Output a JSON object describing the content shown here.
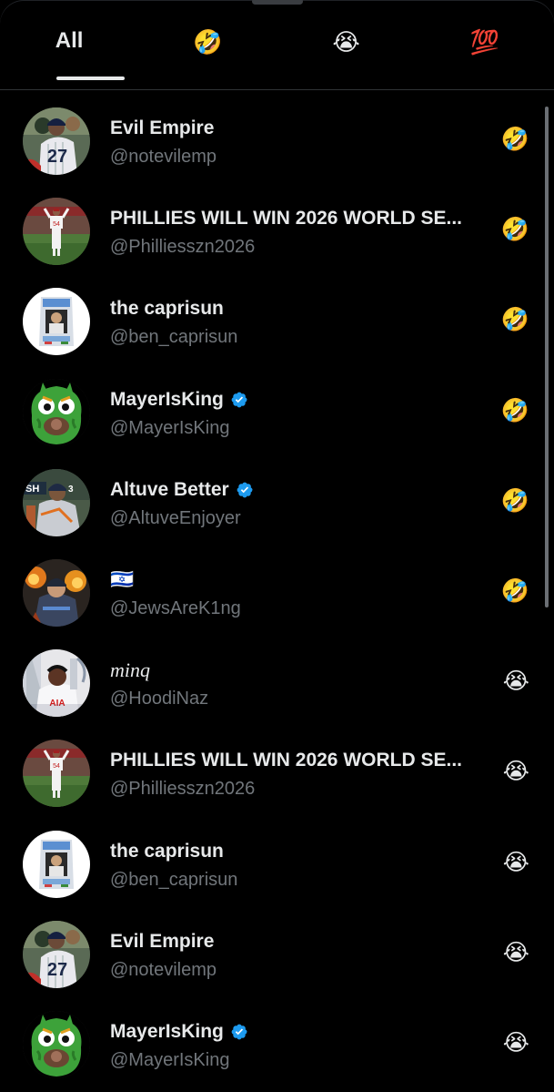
{
  "tabs": [
    {
      "label": "All",
      "type": "text",
      "active": true
    },
    {
      "label": "🤣",
      "type": "emoji",
      "icon": "rolling-laughing-emoji"
    },
    {
      "label": "😭",
      "type": "emoji",
      "icon": "loudly-crying-emoji"
    },
    {
      "label": "💯",
      "type": "emoji",
      "icon": "hundred-points-emoji"
    }
  ],
  "colors": {
    "accent": "#1d9bf0",
    "muted": "#71767b",
    "text": "#e7e9ea",
    "background": "#000000"
  },
  "reactions": [
    {
      "name": "Evil Empire",
      "handle": "@notevilemp",
      "verified": false,
      "reaction": "🤣",
      "avatar": "yankees-player-27"
    },
    {
      "name": "PHILLIES WILL WIN 2026 WORLD SE...",
      "handle": "@Philliesszn2026",
      "verified": false,
      "reaction": "🤣",
      "avatar": "phillies-player-field"
    },
    {
      "name": "the caprisun",
      "handle": "@ben_caprisun",
      "verified": false,
      "reaction": "🤣",
      "avatar": "capri-sun-pouch"
    },
    {
      "name": "MayerIsKing",
      "handle": "@MayerIsKing",
      "verified": true,
      "reaction": "🤣",
      "avatar": "green-mascot"
    },
    {
      "name": "Altuve Better",
      "handle": "@AltuveEnjoyer",
      "verified": true,
      "reaction": "🤣",
      "avatar": "astros-player"
    },
    {
      "name": "🇮🇱",
      "handle": "@JewsAreK1ng",
      "verified": false,
      "reaction": "🤣",
      "avatar": "player-fire"
    },
    {
      "name": "minq",
      "handle": "@HoodiNaz",
      "verified": false,
      "reaction": "😭",
      "avatar": "soccer-trophy",
      "italic": true
    },
    {
      "name": "PHILLIES WILL WIN 2026 WORLD SE...",
      "handle": "@Philliesszn2026",
      "verified": false,
      "reaction": "😭",
      "avatar": "phillies-player-field"
    },
    {
      "name": "the caprisun",
      "handle": "@ben_caprisun",
      "verified": false,
      "reaction": "😭",
      "avatar": "capri-sun-pouch"
    },
    {
      "name": "Evil Empire",
      "handle": "@notevilemp",
      "verified": false,
      "reaction": "😭",
      "avatar": "yankees-player-27"
    },
    {
      "name": "MayerIsKing",
      "handle": "@MayerIsKing",
      "verified": true,
      "reaction": "😭",
      "avatar": "green-mascot"
    }
  ]
}
